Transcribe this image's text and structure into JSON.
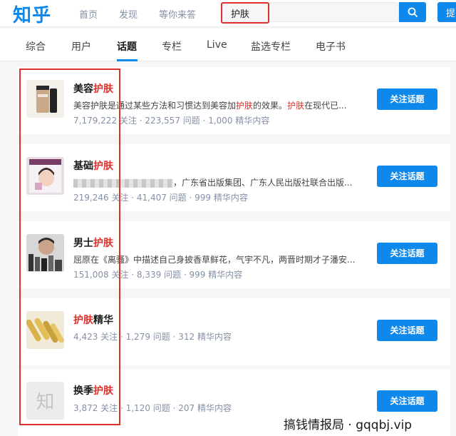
{
  "header": {
    "logo": "知乎",
    "nav": [
      "首页",
      "发现",
      "等你来答"
    ],
    "search_value": "护肤",
    "ask_label": "提"
  },
  "tabs": [
    "综合",
    "用户",
    "话题",
    "专栏",
    "Live",
    "盐选专栏",
    "电子书"
  ],
  "active_tab": "话题",
  "results": [
    {
      "title_plain": "美容",
      "title_hl": "护肤",
      "desc_parts": [
        "美容护肤是",
        "通过某些方法和习惯达到美容加",
        "护肤",
        "的效果。",
        "护肤",
        "在现代已..."
      ],
      "meta": "7,179,222 关注 · 223,557 问题 · 1,000 精华内容",
      "button": "关注话题",
      "thumb": "cosmetic-tube"
    },
    {
      "title_plain": "基础",
      "title_hl": "护肤",
      "desc_parts": [
        "",
        "，广东省出版集团、广东人民出版社联合出版..."
      ],
      "meta": "219,246 关注 · 41,407 问题 · 999 精华内容",
      "button": "关注话题",
      "thumb": "woman-face"
    },
    {
      "title_plain": "男士",
      "title_hl": "护肤",
      "desc_parts": [
        "屈原在《离骚》中描述自己身披香草鲜花，气宇不凡，两晋时期才子潘安..."
      ],
      "meta": "151,008 关注 · 8,339 问题 · 999 精华内容",
      "button": "关注话题",
      "thumb": "man-products"
    },
    {
      "title_hl": "护肤",
      "title_plain": "精华",
      "meta": "4,423 关注 · 1,279 问题 · 312 精华内容",
      "button": "关注话题",
      "thumb": "ampoules"
    },
    {
      "title_plain": "换季",
      "title_hl": "护肤",
      "meta": "3,872 关注 · 1,120 问题 · 207 精华内容",
      "button": "关注话题",
      "thumb": "zhi-placeholder",
      "thumb_text": "知"
    }
  ],
  "watermark": "搞钱情报局 · gqqbj.vip",
  "colors": {
    "brand_blue": "#0f88eb",
    "highlight_red": "#e0302b",
    "meta_gray": "#8590a6"
  }
}
